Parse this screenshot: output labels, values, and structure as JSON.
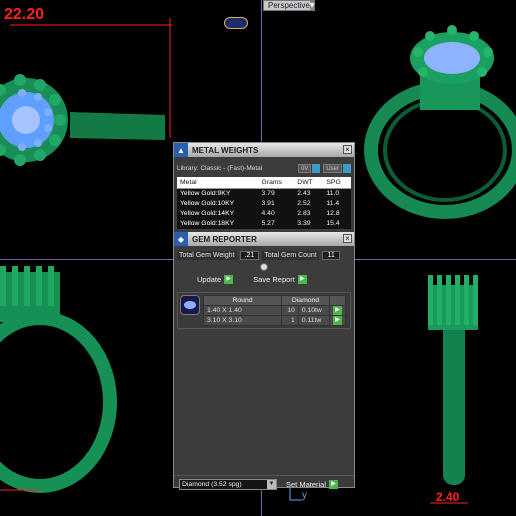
{
  "viewport": {
    "dimension_top": "22.20",
    "dimension_bottom": "2.40",
    "axis_label": "y",
    "perspective_tab": "Perspective",
    "colors": {
      "ring_green": "#1a8f5a",
      "gem_blue": "#8fb0ff",
      "dimension_red": "#ff2020",
      "grid_line": "#7a5fb0"
    }
  },
  "metal_weights": {
    "title": "METAL WEIGHTS",
    "library": "Library: Classic - (Fast)-Metal",
    "button_0v": "0V",
    "button_user": "User",
    "columns": [
      "Metal",
      "Grams",
      "DWT",
      "SPG"
    ],
    "rows": [
      [
        "Yellow Gold:9KY",
        "3.79",
        "2.43",
        "11.0"
      ],
      [
        "Yellow Gold:10KY",
        "3.91",
        "2.52",
        "11.4"
      ],
      [
        "Yellow Gold:14KY",
        "4.40",
        "2.83",
        "12.8"
      ],
      [
        "Yellow Gold:18KY",
        "5.27",
        "3.39",
        "15.4"
      ]
    ]
  },
  "gem_reporter": {
    "title": "GEM REPORTER",
    "total_weight_label": "Total Gem Weight",
    "total_weight_value": ".21",
    "total_count_label": "Total Gem Count",
    "total_count_value": "11",
    "update_label": "Update",
    "save_label": "Save Report",
    "table_headers": [
      "Round",
      "Diamond"
    ],
    "rows": [
      [
        "1.40 X 1.40",
        "10",
        "0.10tw"
      ],
      [
        "3.10 X 3.10",
        "1",
        "0.11tw"
      ]
    ],
    "material_select": "Diamond    (3.52 spg)",
    "set_material_label": "Set Material"
  }
}
